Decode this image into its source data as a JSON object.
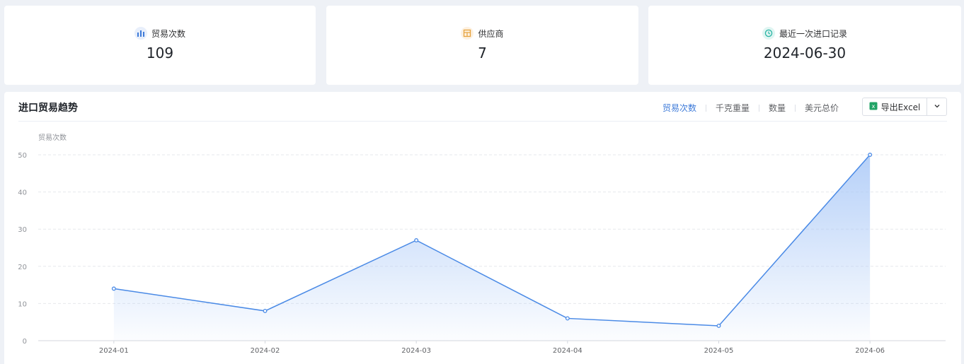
{
  "cards": [
    {
      "label": "贸易次数",
      "value": "109",
      "icon": "bar-chart-icon",
      "color": "#3e7bd9",
      "bg": "#e8effb"
    },
    {
      "label": "供应商",
      "value": "7",
      "icon": "supplier-icon",
      "color": "#e6a23c",
      "bg": "#fdf1e1"
    },
    {
      "label": "最近一次进口记录",
      "value": "2024-06-30",
      "icon": "clock-icon",
      "color": "#2bb5a5",
      "bg": "#e0f5f2"
    }
  ],
  "panel": {
    "title": "进口贸易趋势",
    "tabs": [
      {
        "label": "贸易次数",
        "active": true
      },
      {
        "label": "千克重量",
        "active": false
      },
      {
        "label": "数量",
        "active": false
      },
      {
        "label": "美元总价",
        "active": false
      }
    ],
    "export_label": "导出Excel"
  },
  "chart_data": {
    "type": "area",
    "ylabel": "贸易次数",
    "categories": [
      "2024-01",
      "2024-02",
      "2024-03",
      "2024-04",
      "2024-05",
      "2024-06"
    ],
    "values": [
      14,
      8,
      27,
      6,
      4,
      50
    ],
    "ylim": [
      0,
      50
    ],
    "yticks": [
      0,
      10,
      20,
      30,
      40,
      50
    ],
    "grid": true,
    "color": "#4a8ae6"
  }
}
